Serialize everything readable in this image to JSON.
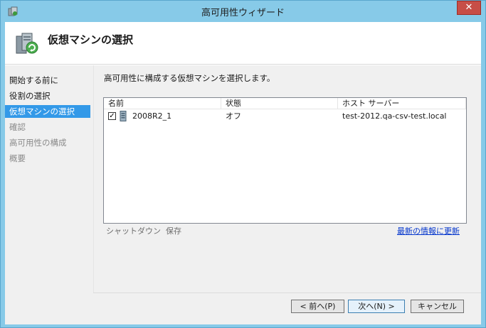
{
  "window": {
    "title": "高可用性ウィザード",
    "close_glyph": "✕"
  },
  "header": {
    "title": "仮想マシンの選択",
    "icon": "server-network-icon"
  },
  "nav": {
    "items": [
      {
        "label": "開始する前に",
        "state": "normal"
      },
      {
        "label": "役割の選択",
        "state": "normal"
      },
      {
        "label": "仮想マシンの選択",
        "state": "active"
      },
      {
        "label": "確認",
        "state": "disabled"
      },
      {
        "label": "高可用性の構成",
        "state": "disabled"
      },
      {
        "label": "概要",
        "state": "disabled"
      }
    ]
  },
  "main": {
    "instruction": "高可用性に構成する仮想マシンを選択します。",
    "table": {
      "columns": [
        "名前",
        "状態",
        "ホスト サーバー"
      ],
      "rows": [
        {
          "checked": true,
          "name": "2008R2_1",
          "state": "オフ",
          "host": "test-2012.qa-csv-test.local"
        }
      ]
    },
    "actions": {
      "shutdown": "シャットダウン",
      "save": "保存",
      "refresh": "最新の情報に更新"
    }
  },
  "buttons": {
    "back": "< 前へ(P)",
    "next": "次へ(N) >",
    "cancel": "キャンセル"
  },
  "colors": {
    "titlebar": "#87cae8",
    "nav_active": "#3399e8",
    "close_button": "#c74e47",
    "link": "#0033cc"
  }
}
